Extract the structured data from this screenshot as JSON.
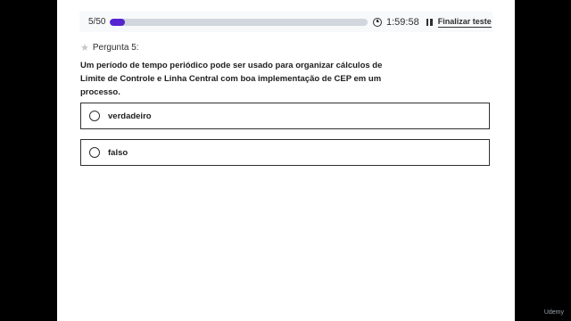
{
  "header": {
    "counter": "5/50",
    "progress_fraction": 0.06,
    "timer": "1:59:58",
    "finish_label": "Finalizar teste"
  },
  "question": {
    "label": "Pergunta 5:",
    "text": "Um período de tempo periódico pode ser usado para organizar cálculos de Limite de Controle e Linha Central com boa implementação de CEP em um processo."
  },
  "options": [
    {
      "label": "verdadeiro"
    },
    {
      "label": "falso"
    }
  ],
  "watermark": "Udemy"
}
